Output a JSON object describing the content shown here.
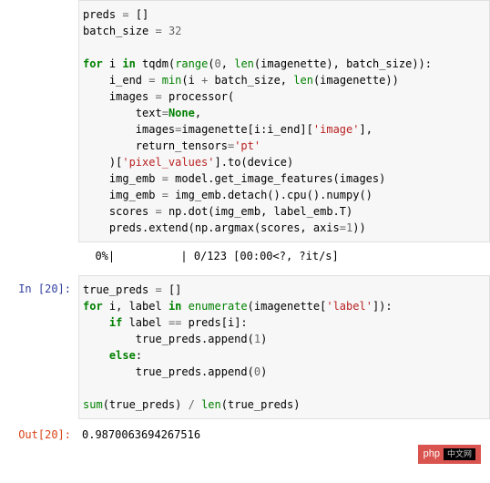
{
  "cell1": {
    "code": {
      "l1": {
        "a": "preds ",
        "b": "=",
        "c": " []"
      },
      "l2": {
        "a": "batch_size ",
        "b": "=",
        "c": " ",
        "d": "32"
      },
      "l3": {
        "a": "for",
        "b": " i ",
        "c": "in",
        "d": " tqdm(",
        "e": "range",
        "f": "(",
        "g": "0",
        "h": ", ",
        "i": "len",
        "j": "(imagenette), batch_size)):"
      },
      "l4": {
        "a": "    i_end ",
        "b": "=",
        "c": " ",
        "d": "min",
        "e": "(i ",
        "f": "+",
        "g": " batch_size, ",
        "h": "len",
        "i": "(imagenette))"
      },
      "l5": {
        "a": "    images ",
        "b": "=",
        "c": " processor("
      },
      "l6": {
        "a": "        text",
        "b": "=",
        "c": "None",
        "d": ","
      },
      "l7": {
        "a": "        images",
        "b": "=",
        "c": "imagenette[i:i_end][",
        "d": "'image'",
        "e": "],"
      },
      "l8": {
        "a": "        return_tensors",
        "b": "=",
        "c": "'pt'"
      },
      "l9": {
        "a": "    )[",
        "b": "'pixel_values'",
        "c": "].to(device)"
      },
      "l10": {
        "a": "    img_emb ",
        "b": "=",
        "c": " model.get_image_features(images)"
      },
      "l11": {
        "a": "    img_emb ",
        "b": "=",
        "c": " img_emb.detach().cpu().numpy()"
      },
      "l12": {
        "a": "    scores ",
        "b": "=",
        "c": " np.dot(img_emb, label_emb.T)"
      },
      "l13": {
        "a": "    preds.extend(np.argmax(scores, axis",
        "b": "=",
        "c": "1",
        "d": "))"
      }
    },
    "output": "  0%|          | 0/123 [00:00<?, ?it/s]"
  },
  "cell2": {
    "prompt_in": "In [20]:",
    "prompt_out": "Out[20]:",
    "code": {
      "l1": {
        "a": "true_preds ",
        "b": "=",
        "c": " []"
      },
      "l2": {
        "a": "for",
        "b": " i, label ",
        "c": "in",
        "d": " ",
        "e": "enumerate",
        "f": "(imagenette[",
        "g": "'label'",
        "h": "]):"
      },
      "l3": {
        "a": "    ",
        "b": "if",
        "c": " label ",
        "d": "==",
        "e": " preds[i]:"
      },
      "l4": {
        "a": "        true_preds.append(",
        "b": "1",
        "c": ")"
      },
      "l5": {
        "a": "    ",
        "b": "else",
        "c": ":"
      },
      "l6": {
        "a": "        true_preds.append(",
        "b": "0",
        "c": ")"
      },
      "l7": {
        "a": "sum",
        "b": "(true_preds) ",
        "c": "/",
        "d": " ",
        "e": "len",
        "f": "(true_preds)"
      }
    },
    "output": "0.9870063694267516"
  },
  "watermark": {
    "text": "php",
    "cn": "中文网"
  }
}
